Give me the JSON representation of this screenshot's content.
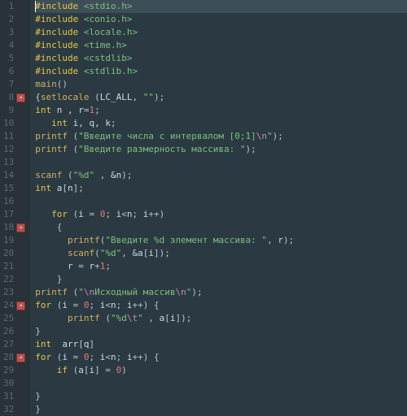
{
  "lines": [
    {
      "n": 1,
      "fold": false,
      "t": [
        [
          "pp",
          "#include "
        ],
        [
          "inc",
          "<stdio.h>"
        ]
      ],
      "highlight": true,
      "cursor": true
    },
    {
      "n": 2,
      "fold": false,
      "t": [
        [
          "pp",
          "#include "
        ],
        [
          "inc",
          "<conio.h>"
        ]
      ]
    },
    {
      "n": 3,
      "fold": false,
      "t": [
        [
          "pp",
          "#include "
        ],
        [
          "inc",
          "<locale.h>"
        ]
      ]
    },
    {
      "n": 4,
      "fold": false,
      "t": [
        [
          "pp",
          "#include "
        ],
        [
          "inc",
          "<time.h>"
        ]
      ]
    },
    {
      "n": 5,
      "fold": false,
      "t": [
        [
          "pp",
          "#include "
        ],
        [
          "inc",
          "<cstdlib>"
        ]
      ]
    },
    {
      "n": 6,
      "fold": false,
      "t": [
        [
          "pp",
          "#include "
        ],
        [
          "inc",
          "<stdlib.h>"
        ]
      ]
    },
    {
      "n": 7,
      "fold": false,
      "t": [
        [
          "fn",
          "main"
        ],
        [
          "op",
          "()"
        ]
      ]
    },
    {
      "n": 8,
      "fold": true,
      "t": [
        [
          "op",
          "{"
        ],
        [
          "fn",
          "setlocale "
        ],
        [
          "op",
          "("
        ],
        [
          "id",
          "LC_ALL"
        ],
        [
          "op",
          ", "
        ],
        [
          "str",
          "\"\""
        ],
        [
          "op",
          ");"
        ]
      ]
    },
    {
      "n": 9,
      "fold": false,
      "t": [
        [
          "kw",
          "int "
        ],
        [
          "id",
          "n , r"
        ],
        [
          "op",
          "="
        ],
        [
          "num",
          "1"
        ],
        [
          "op",
          ";"
        ]
      ]
    },
    {
      "n": 10,
      "fold": false,
      "t": [
        [
          "id",
          "   "
        ],
        [
          "kw",
          "int "
        ],
        [
          "id",
          "i, q, k"
        ],
        [
          "op",
          ";"
        ]
      ]
    },
    {
      "n": 11,
      "fold": false,
      "t": [
        [
          "fn",
          "printf "
        ],
        [
          "op",
          "("
        ],
        [
          "str",
          "\"Введите числа с интервалом [0;1]"
        ],
        [
          "esc",
          "\\n"
        ],
        [
          "str",
          "\""
        ],
        [
          "op",
          ");"
        ]
      ]
    },
    {
      "n": 12,
      "fold": false,
      "t": [
        [
          "fn",
          "printf "
        ],
        [
          "op",
          "("
        ],
        [
          "str",
          "\"Введите размерность массива: \""
        ],
        [
          "op",
          ");"
        ]
      ]
    },
    {
      "n": 13,
      "fold": false,
      "t": []
    },
    {
      "n": 14,
      "fold": false,
      "t": [
        [
          "fn",
          "scanf "
        ],
        [
          "op",
          "("
        ],
        [
          "str",
          "\"%d\""
        ],
        [
          "op",
          " , "
        ],
        [
          "id",
          "&n"
        ],
        [
          "op",
          ");"
        ]
      ]
    },
    {
      "n": 15,
      "fold": false,
      "t": [
        [
          "kw",
          "int "
        ],
        [
          "id",
          "a"
        ],
        [
          "op",
          "["
        ],
        [
          "id",
          "n"
        ],
        [
          "op",
          "];"
        ]
      ]
    },
    {
      "n": 16,
      "fold": false,
      "t": []
    },
    {
      "n": 17,
      "fold": false,
      "t": [
        [
          "id",
          "   "
        ],
        [
          "kw",
          "for "
        ],
        [
          "op",
          "("
        ],
        [
          "id",
          "i "
        ],
        [
          "op",
          "= "
        ],
        [
          "num",
          "0"
        ],
        [
          "op",
          "; "
        ],
        [
          "id",
          "i"
        ],
        [
          "op",
          "<"
        ],
        [
          "id",
          "n"
        ],
        [
          "op",
          "; "
        ],
        [
          "id",
          "i"
        ],
        [
          "op",
          "++)"
        ]
      ]
    },
    {
      "n": 18,
      "fold": true,
      "t": [
        [
          "id",
          "    "
        ],
        [
          "op",
          "{"
        ]
      ]
    },
    {
      "n": 19,
      "fold": false,
      "t": [
        [
          "id",
          "      "
        ],
        [
          "fn",
          "printf"
        ],
        [
          "op",
          "("
        ],
        [
          "str",
          "\"Введите %d элемент массива: \""
        ],
        [
          "op",
          ", "
        ],
        [
          "id",
          "r"
        ],
        [
          "op",
          ");"
        ]
      ]
    },
    {
      "n": 20,
      "fold": false,
      "t": [
        [
          "id",
          "      "
        ],
        [
          "fn",
          "scanf"
        ],
        [
          "op",
          "("
        ],
        [
          "str",
          "\"%d\""
        ],
        [
          "op",
          ", "
        ],
        [
          "id",
          "&a"
        ],
        [
          "op",
          "["
        ],
        [
          "id",
          "i"
        ],
        [
          "op",
          "]);"
        ]
      ]
    },
    {
      "n": 21,
      "fold": false,
      "t": [
        [
          "id",
          "      "
        ],
        [
          "id",
          "r "
        ],
        [
          "op",
          "= "
        ],
        [
          "id",
          "r"
        ],
        [
          "op",
          "+"
        ],
        [
          "num",
          "1"
        ],
        [
          "op",
          ";"
        ]
      ]
    },
    {
      "n": 22,
      "fold": false,
      "t": [
        [
          "id",
          "    "
        ],
        [
          "op",
          "}"
        ]
      ]
    },
    {
      "n": 23,
      "fold": false,
      "t": [
        [
          "fn",
          "printf "
        ],
        [
          "op",
          "("
        ],
        [
          "str",
          "\""
        ],
        [
          "esc",
          "\\n"
        ],
        [
          "str",
          "Исходный массив"
        ],
        [
          "esc",
          "\\n"
        ],
        [
          "str",
          "\""
        ],
        [
          "op",
          ");"
        ]
      ]
    },
    {
      "n": 24,
      "fold": true,
      "t": [
        [
          "kw",
          "for "
        ],
        [
          "op",
          "("
        ],
        [
          "id",
          "i "
        ],
        [
          "op",
          "= "
        ],
        [
          "num",
          "0"
        ],
        [
          "op",
          "; "
        ],
        [
          "id",
          "i"
        ],
        [
          "op",
          "<"
        ],
        [
          "id",
          "n"
        ],
        [
          "op",
          "; "
        ],
        [
          "id",
          "i"
        ],
        [
          "op",
          "++) {"
        ]
      ]
    },
    {
      "n": 25,
      "fold": false,
      "t": [
        [
          "id",
          "      "
        ],
        [
          "fn",
          "printf "
        ],
        [
          "op",
          "("
        ],
        [
          "str",
          "\"%d"
        ],
        [
          "esc",
          "\\t"
        ],
        [
          "str",
          "\""
        ],
        [
          "op",
          " , "
        ],
        [
          "id",
          "a"
        ],
        [
          "op",
          "["
        ],
        [
          "id",
          "i"
        ],
        [
          "op",
          "]);"
        ]
      ]
    },
    {
      "n": 26,
      "fold": false,
      "t": [
        [
          "op",
          "}"
        ]
      ]
    },
    {
      "n": 27,
      "fold": false,
      "t": [
        [
          "kw",
          "int  "
        ],
        [
          "id",
          "arr"
        ],
        [
          "op",
          "["
        ],
        [
          "id",
          "q"
        ],
        [
          "op",
          "]"
        ]
      ]
    },
    {
      "n": 28,
      "fold": true,
      "t": [
        [
          "kw",
          "for "
        ],
        [
          "op",
          "("
        ],
        [
          "id",
          "i "
        ],
        [
          "op",
          "= "
        ],
        [
          "num",
          "0"
        ],
        [
          "op",
          "; "
        ],
        [
          "id",
          "i"
        ],
        [
          "op",
          "<"
        ],
        [
          "id",
          "n"
        ],
        [
          "op",
          "; "
        ],
        [
          "id",
          "i"
        ],
        [
          "op",
          "++) {"
        ]
      ]
    },
    {
      "n": 29,
      "fold": false,
      "t": [
        [
          "id",
          "    "
        ],
        [
          "kw",
          "if "
        ],
        [
          "op",
          "("
        ],
        [
          "id",
          "a"
        ],
        [
          "op",
          "["
        ],
        [
          "id",
          "i"
        ],
        [
          "op",
          "] "
        ],
        [
          "op",
          "= "
        ],
        [
          "num",
          "0"
        ],
        [
          "op",
          ")"
        ]
      ]
    },
    {
      "n": 30,
      "fold": false,
      "t": []
    },
    {
      "n": 31,
      "fold": false,
      "t": [
        [
          "op",
          "}"
        ]
      ]
    },
    {
      "n": 32,
      "fold": false,
      "t": [
        [
          "op",
          "}"
        ]
      ]
    }
  ]
}
